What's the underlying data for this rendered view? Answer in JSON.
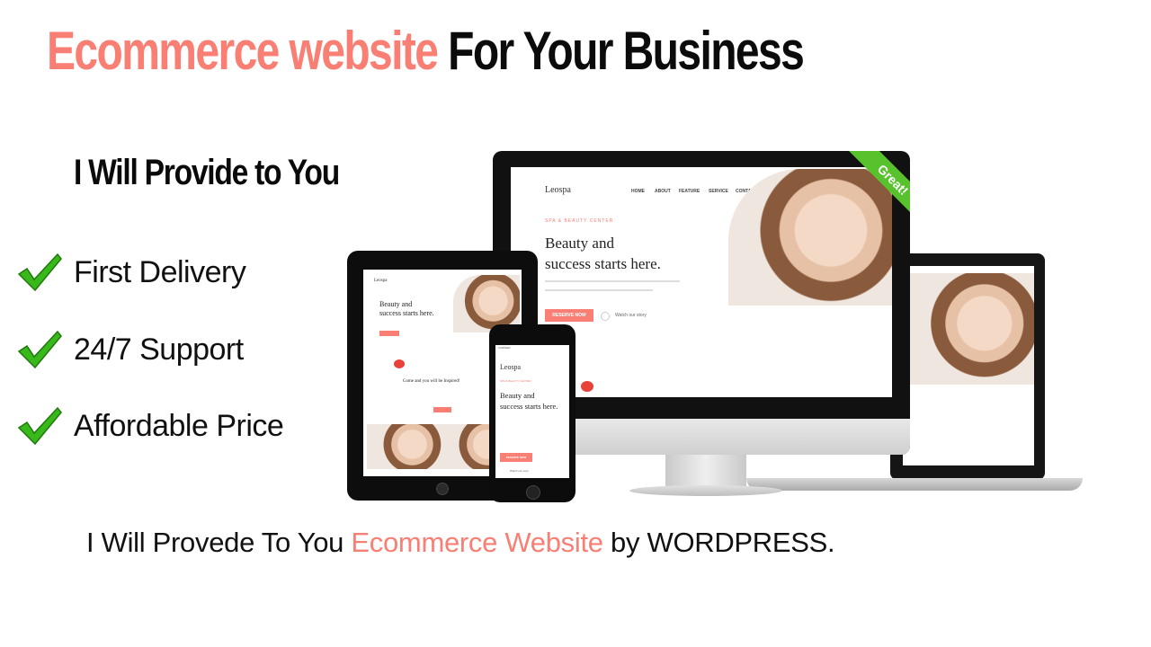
{
  "headline": {
    "accent": "Ecommerce website",
    "rest": "For Your Business"
  },
  "subheading": "I Will Provide to You",
  "features": [
    {
      "label": "First Delivery",
      "icon": "check-icon"
    },
    {
      "label": "24/7 Support",
      "icon": "check-icon"
    },
    {
      "label": "Affordable Price",
      "icon": "check-icon"
    }
  ],
  "bottom": {
    "before": "I Will Provede To You ",
    "accent": "Ecommerce Website",
    "after": " by WORDPRESS."
  },
  "colors": {
    "accent": "#f97f74",
    "check": "#38b81a",
    "ribbon": "#58c22d"
  },
  "mockup": {
    "brand": "Leospa",
    "nav": [
      "HOME",
      "ABOUT",
      "FEATURE",
      "SERVICE",
      "CONTACT"
    ],
    "eyebrow": "SPA & BEAUTY CENTER",
    "hero_line1": "Beauty and",
    "hero_line2": "success starts here.",
    "cta": "RESERVE NOW",
    "watch": "Watch our story",
    "section_title": "Come and you will be Inspired!",
    "ribbon": "Great!",
    "phone_carrier": "CARRIER"
  }
}
